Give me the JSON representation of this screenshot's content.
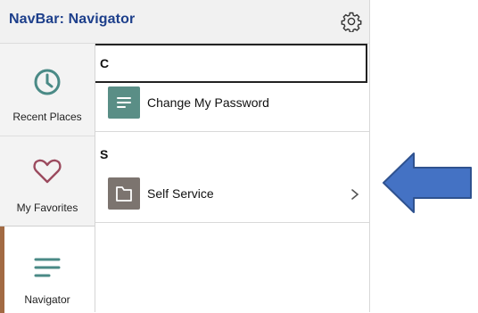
{
  "header": {
    "title": "NavBar: Navigator",
    "settings_icon": "gear-icon"
  },
  "sidebar": {
    "items": [
      {
        "label": "Recent Places",
        "icon": "clock-icon"
      },
      {
        "label": "My Favorites",
        "icon": "heart-icon"
      },
      {
        "label": "Navigator",
        "icon": "menu-lines-icon",
        "active": true
      }
    ]
  },
  "content": {
    "sections": [
      {
        "letter": "C",
        "items": [
          {
            "label": "Change My Password",
            "icon": "document-icon",
            "color": "#5a8e86"
          }
        ]
      },
      {
        "letter": "S",
        "items": [
          {
            "label": "Self Service",
            "icon": "folder-icon",
            "color": "#7c746f",
            "has_children": true
          }
        ]
      }
    ]
  },
  "annotation": {
    "arrow_color": "#4472c4",
    "arrow_direction": "left"
  },
  "colors": {
    "title": "#1d3f8b",
    "active_accent": "#a26a43",
    "icon_teal": "#4a8a86",
    "icon_heart": "#9b4a5e"
  }
}
